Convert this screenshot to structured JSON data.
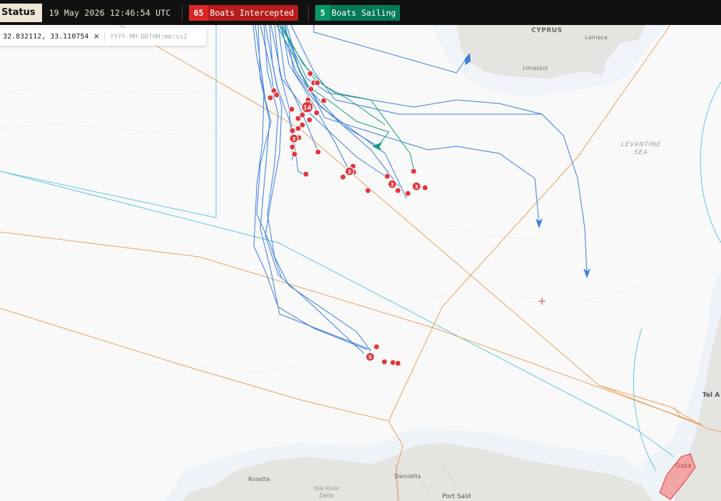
{
  "header": {
    "status_label": "Status",
    "datetime": "19 May 2026 12:46:54 UTC",
    "intercepted": {
      "count": "65",
      "label": "Boats Intercepted"
    },
    "sailing": {
      "count": "5",
      "label": "Boats Sailing"
    }
  },
  "cursor_panel": {
    "coordinates": "32.832112, 33.110754",
    "clear_symbol": "×",
    "datetime_placeholder": "YYYY-MM-DDTHH:mm:ssZ"
  },
  "map_labels": {
    "cyprus": "CYPRUS",
    "larnaca": "Larnaca",
    "limassol": "Limassol",
    "sea_line1": "LEVANTINE",
    "sea_line2": "SEA",
    "tel_aviv": "Tel A",
    "gaza": "Gaza",
    "rosetta": "Rosetta",
    "damietta": "Damietta",
    "nile_line1": "Nile River",
    "nile_line2": "Delta",
    "port_said": "Port Said"
  },
  "cluster_counts": {
    "c14": "14",
    "c3a": "3",
    "c3b": "3",
    "c2": "2",
    "c3c": "3",
    "c5": "5"
  },
  "colors": {
    "intercepted": "#e0383b",
    "sailing": "#0f9d7a",
    "track": "#3b7de0",
    "eez": "#e8a05c",
    "zone": "#5cc8dc",
    "land": "#e8e6e2"
  }
}
